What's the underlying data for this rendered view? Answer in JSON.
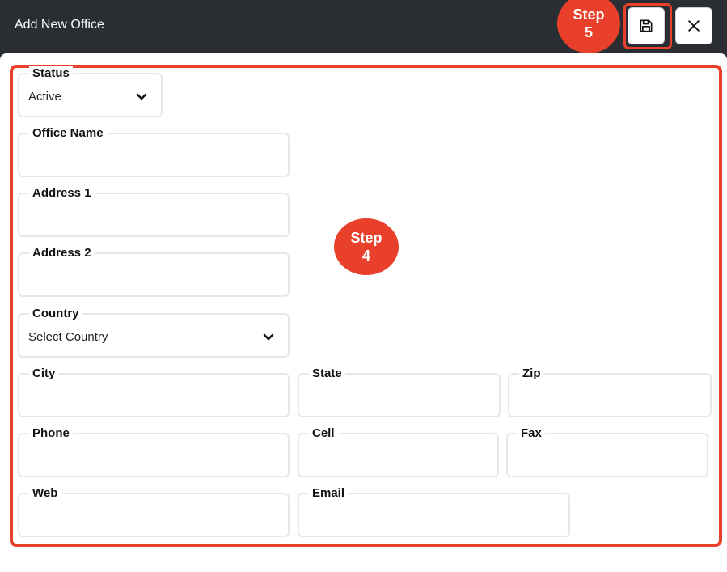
{
  "window": {
    "title": "Add New Office",
    "save_icon": "save-icon",
    "close_icon": "close-icon"
  },
  "annotations": {
    "step5_line1": "Step",
    "step5_line2": "5",
    "step4_line1": "Step",
    "step4_line2": "4",
    "highlight_color": "#e8402a"
  },
  "form": {
    "status": {
      "label": "Status",
      "value": "Active"
    },
    "office_name": {
      "label": "Office Name",
      "value": ""
    },
    "address1": {
      "label": "Address 1",
      "value": ""
    },
    "address2": {
      "label": "Address 2",
      "value": ""
    },
    "country": {
      "label": "Country",
      "value": "Select Country"
    },
    "city": {
      "label": "City",
      "value": ""
    },
    "state": {
      "label": "State",
      "value": ""
    },
    "zip": {
      "label": "Zip",
      "value": ""
    },
    "phone": {
      "label": "Phone",
      "value": ""
    },
    "cell": {
      "label": "Cell",
      "value": ""
    },
    "fax": {
      "label": "Fax",
      "value": ""
    },
    "web": {
      "label": "Web",
      "value": ""
    },
    "email": {
      "label": "Email",
      "value": ""
    }
  }
}
